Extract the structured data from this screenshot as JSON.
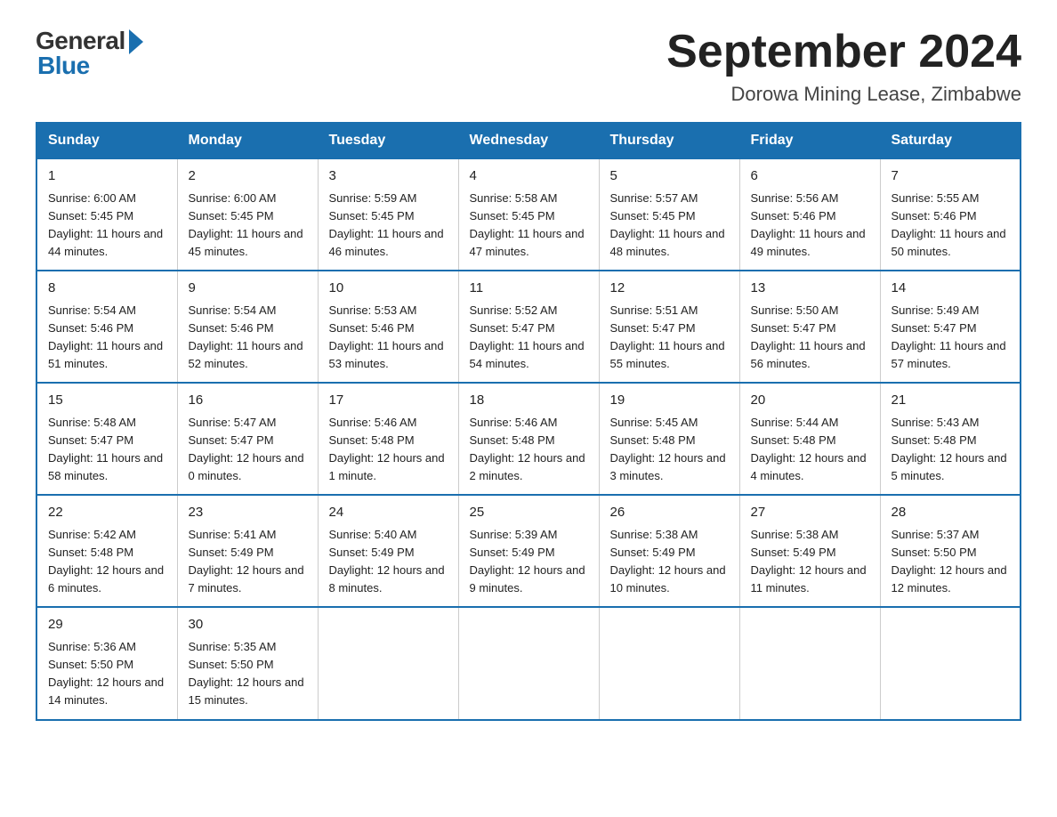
{
  "header": {
    "title": "September 2024",
    "subtitle": "Dorowa Mining Lease, Zimbabwe",
    "logo_general": "General",
    "logo_blue": "Blue"
  },
  "days_of_week": [
    "Sunday",
    "Monday",
    "Tuesday",
    "Wednesday",
    "Thursday",
    "Friday",
    "Saturday"
  ],
  "weeks": [
    [
      {
        "day": "1",
        "sunrise": "Sunrise: 6:00 AM",
        "sunset": "Sunset: 5:45 PM",
        "daylight": "Daylight: 11 hours and 44 minutes."
      },
      {
        "day": "2",
        "sunrise": "Sunrise: 6:00 AM",
        "sunset": "Sunset: 5:45 PM",
        "daylight": "Daylight: 11 hours and 45 minutes."
      },
      {
        "day": "3",
        "sunrise": "Sunrise: 5:59 AM",
        "sunset": "Sunset: 5:45 PM",
        "daylight": "Daylight: 11 hours and 46 minutes."
      },
      {
        "day": "4",
        "sunrise": "Sunrise: 5:58 AM",
        "sunset": "Sunset: 5:45 PM",
        "daylight": "Daylight: 11 hours and 47 minutes."
      },
      {
        "day": "5",
        "sunrise": "Sunrise: 5:57 AM",
        "sunset": "Sunset: 5:45 PM",
        "daylight": "Daylight: 11 hours and 48 minutes."
      },
      {
        "day": "6",
        "sunrise": "Sunrise: 5:56 AM",
        "sunset": "Sunset: 5:46 PM",
        "daylight": "Daylight: 11 hours and 49 minutes."
      },
      {
        "day": "7",
        "sunrise": "Sunrise: 5:55 AM",
        "sunset": "Sunset: 5:46 PM",
        "daylight": "Daylight: 11 hours and 50 minutes."
      }
    ],
    [
      {
        "day": "8",
        "sunrise": "Sunrise: 5:54 AM",
        "sunset": "Sunset: 5:46 PM",
        "daylight": "Daylight: 11 hours and 51 minutes."
      },
      {
        "day": "9",
        "sunrise": "Sunrise: 5:54 AM",
        "sunset": "Sunset: 5:46 PM",
        "daylight": "Daylight: 11 hours and 52 minutes."
      },
      {
        "day": "10",
        "sunrise": "Sunrise: 5:53 AM",
        "sunset": "Sunset: 5:46 PM",
        "daylight": "Daylight: 11 hours and 53 minutes."
      },
      {
        "day": "11",
        "sunrise": "Sunrise: 5:52 AM",
        "sunset": "Sunset: 5:47 PM",
        "daylight": "Daylight: 11 hours and 54 minutes."
      },
      {
        "day": "12",
        "sunrise": "Sunrise: 5:51 AM",
        "sunset": "Sunset: 5:47 PM",
        "daylight": "Daylight: 11 hours and 55 minutes."
      },
      {
        "day": "13",
        "sunrise": "Sunrise: 5:50 AM",
        "sunset": "Sunset: 5:47 PM",
        "daylight": "Daylight: 11 hours and 56 minutes."
      },
      {
        "day": "14",
        "sunrise": "Sunrise: 5:49 AM",
        "sunset": "Sunset: 5:47 PM",
        "daylight": "Daylight: 11 hours and 57 minutes."
      }
    ],
    [
      {
        "day": "15",
        "sunrise": "Sunrise: 5:48 AM",
        "sunset": "Sunset: 5:47 PM",
        "daylight": "Daylight: 11 hours and 58 minutes."
      },
      {
        "day": "16",
        "sunrise": "Sunrise: 5:47 AM",
        "sunset": "Sunset: 5:47 PM",
        "daylight": "Daylight: 12 hours and 0 minutes."
      },
      {
        "day": "17",
        "sunrise": "Sunrise: 5:46 AM",
        "sunset": "Sunset: 5:48 PM",
        "daylight": "Daylight: 12 hours and 1 minute."
      },
      {
        "day": "18",
        "sunrise": "Sunrise: 5:46 AM",
        "sunset": "Sunset: 5:48 PM",
        "daylight": "Daylight: 12 hours and 2 minutes."
      },
      {
        "day": "19",
        "sunrise": "Sunrise: 5:45 AM",
        "sunset": "Sunset: 5:48 PM",
        "daylight": "Daylight: 12 hours and 3 minutes."
      },
      {
        "day": "20",
        "sunrise": "Sunrise: 5:44 AM",
        "sunset": "Sunset: 5:48 PM",
        "daylight": "Daylight: 12 hours and 4 minutes."
      },
      {
        "day": "21",
        "sunrise": "Sunrise: 5:43 AM",
        "sunset": "Sunset: 5:48 PM",
        "daylight": "Daylight: 12 hours and 5 minutes."
      }
    ],
    [
      {
        "day": "22",
        "sunrise": "Sunrise: 5:42 AM",
        "sunset": "Sunset: 5:48 PM",
        "daylight": "Daylight: 12 hours and 6 minutes."
      },
      {
        "day": "23",
        "sunrise": "Sunrise: 5:41 AM",
        "sunset": "Sunset: 5:49 PM",
        "daylight": "Daylight: 12 hours and 7 minutes."
      },
      {
        "day": "24",
        "sunrise": "Sunrise: 5:40 AM",
        "sunset": "Sunset: 5:49 PM",
        "daylight": "Daylight: 12 hours and 8 minutes."
      },
      {
        "day": "25",
        "sunrise": "Sunrise: 5:39 AM",
        "sunset": "Sunset: 5:49 PM",
        "daylight": "Daylight: 12 hours and 9 minutes."
      },
      {
        "day": "26",
        "sunrise": "Sunrise: 5:38 AM",
        "sunset": "Sunset: 5:49 PM",
        "daylight": "Daylight: 12 hours and 10 minutes."
      },
      {
        "day": "27",
        "sunrise": "Sunrise: 5:38 AM",
        "sunset": "Sunset: 5:49 PM",
        "daylight": "Daylight: 12 hours and 11 minutes."
      },
      {
        "day": "28",
        "sunrise": "Sunrise: 5:37 AM",
        "sunset": "Sunset: 5:50 PM",
        "daylight": "Daylight: 12 hours and 12 minutes."
      }
    ],
    [
      {
        "day": "29",
        "sunrise": "Sunrise: 5:36 AM",
        "sunset": "Sunset: 5:50 PM",
        "daylight": "Daylight: 12 hours and 14 minutes."
      },
      {
        "day": "30",
        "sunrise": "Sunrise: 5:35 AM",
        "sunset": "Sunset: 5:50 PM",
        "daylight": "Daylight: 12 hours and 15 minutes."
      },
      {
        "day": "",
        "sunrise": "",
        "sunset": "",
        "daylight": ""
      },
      {
        "day": "",
        "sunrise": "",
        "sunset": "",
        "daylight": ""
      },
      {
        "day": "",
        "sunrise": "",
        "sunset": "",
        "daylight": ""
      },
      {
        "day": "",
        "sunrise": "",
        "sunset": "",
        "daylight": ""
      },
      {
        "day": "",
        "sunrise": "",
        "sunset": "",
        "daylight": ""
      }
    ]
  ]
}
